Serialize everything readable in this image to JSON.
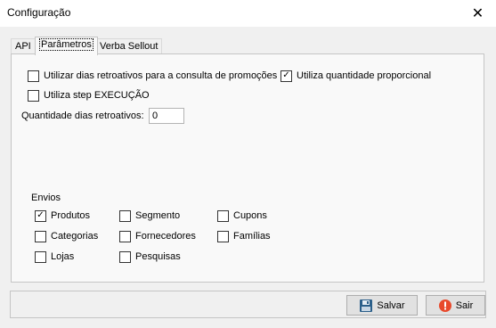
{
  "window": {
    "title": "Configuração"
  },
  "tabs": [
    {
      "label": "API",
      "active": false
    },
    {
      "label": "Parâmetros",
      "active": true
    },
    {
      "label": "Verba Sellout",
      "active": false
    }
  ],
  "parametros": {
    "options": [
      {
        "label": "Utilizar dias retroativos para a consulta de promoções",
        "checked": false
      },
      {
        "label": "Utiliza quantidade proporcional",
        "checked": true
      },
      {
        "label": "Utiliza step EXECUÇÃO",
        "checked": false
      }
    ],
    "dias_retroativos": {
      "label": "Quantidade dias retroativos:",
      "value": "0"
    },
    "envios": {
      "label": "Envios",
      "items": [
        {
          "label": "Produtos",
          "checked": true
        },
        {
          "label": "Segmento",
          "checked": false
        },
        {
          "label": "Cupons",
          "checked": false
        },
        {
          "label": "Categorias",
          "checked": false
        },
        {
          "label": "Fornecedores",
          "checked": false
        },
        {
          "label": "Famílias",
          "checked": false
        },
        {
          "label": "Lojas",
          "checked": false
        },
        {
          "label": "Pesquisas",
          "checked": false
        }
      ]
    }
  },
  "buttons": {
    "save": "Salvar",
    "exit": "Sair"
  },
  "colors": {
    "save_icon": "#2b5f8a",
    "exit_icon": "#e8492c"
  }
}
